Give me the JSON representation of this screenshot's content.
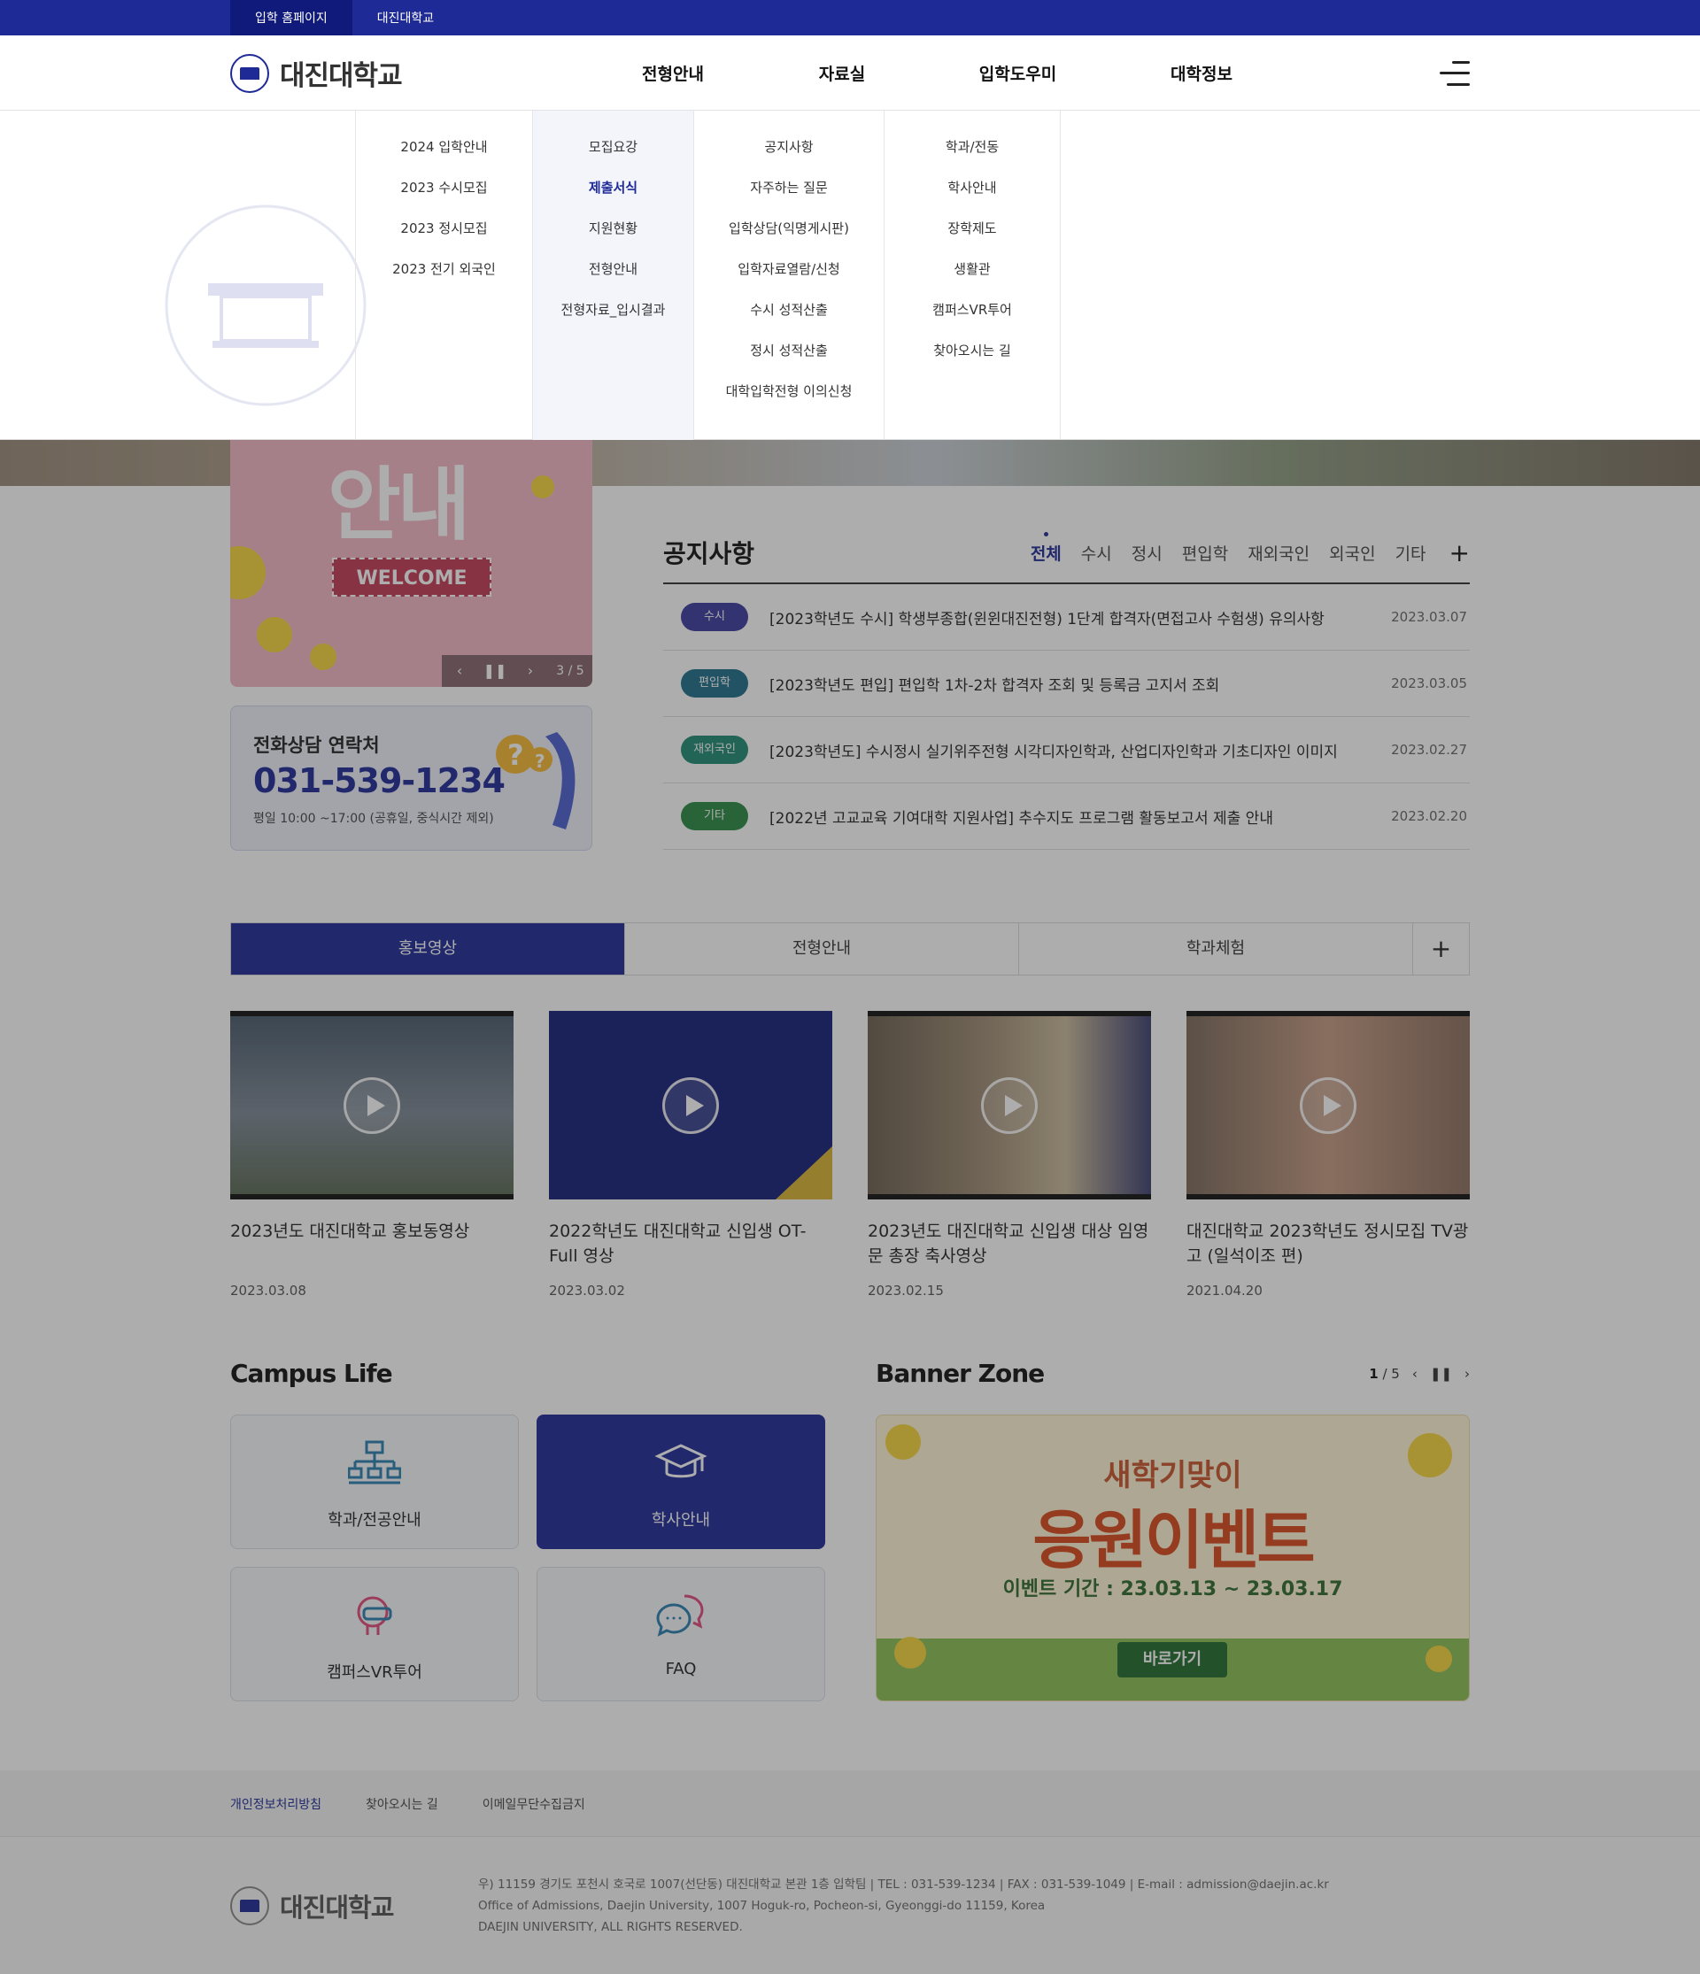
{
  "util_bar": {
    "links": [
      "입학 홈페이지",
      "대진대학교"
    ]
  },
  "header": {
    "logo_text": "대진대학교",
    "gnb": [
      "전형안내",
      "자료실",
      "입학도우미",
      "대학정보"
    ]
  },
  "mega_menu": {
    "col1": [
      "2024 입학안내",
      "2023 수시모집",
      "2023 정시모집",
      "2023 전기 외국인"
    ],
    "col2": [
      "모집요강",
      "제출서식",
      "지원현황",
      "전형안내",
      "전형자료_입시결과"
    ],
    "col3": [
      "공지사항",
      "자주하는 질문",
      "입학상담(익명게시판)",
      "입학자료열람/신청",
      "수시 성적산출",
      "정시 성적산출",
      "대학입학전형 이의신청"
    ],
    "col4": [
      "학과/전동",
      "학사안내",
      "장학제도",
      "생활관",
      "캠퍼스VR투어",
      "찾아오시는 길"
    ],
    "active_item": "제출서식"
  },
  "promo": {
    "title": "안내",
    "welcome": "WELCOME",
    "counter": "3 / 5"
  },
  "call": {
    "title": "전화상담 연락처",
    "number": "031-539-1234",
    "hours": "평일 10:00 ~17:00 (공휴일, 중식시간 제외)"
  },
  "notice": {
    "title": "공지사항",
    "tabs": [
      "전체",
      "수시",
      "정시",
      "편입학",
      "재외국인",
      "외국인",
      "기타"
    ],
    "rows": [
      {
        "badge": "수시",
        "badge_color": "#3b3a9e",
        "title": "[2023학년도 수시] 학생부종합(윈윈대진전형) 1단계 합격자(면접고사 수험생) 유의사항",
        "date": "2023.03.07"
      },
      {
        "badge": "편입학",
        "badge_color": "#1e6f8a",
        "title": "[2023학년도 편입] 편입학 1차-2차 합격자 조회 및 등록금 고지서 조회",
        "date": "2023.03.05"
      },
      {
        "badge": "재외국인",
        "badge_color": "#1f8a73",
        "title": "[2023학년도] 수시정시 실기위주전형 시각디자인학과, 산업디자인학과 기초디자인 이미지",
        "date": "2023.02.27"
      },
      {
        "badge": "기타",
        "badge_color": "#2b8a44",
        "title": "[2022년 고교교육 기여대학 지원사업] 추수지도 프로그램 활동보고서 제출 안내",
        "date": "2023.02.20"
      }
    ]
  },
  "video_tabs": [
    "홍보영상",
    "전형안내",
    "학과체험"
  ],
  "videos": [
    {
      "title": "2023년도 대진대학교 홍보동영상",
      "date": "2023.03.08"
    },
    {
      "title": "2022학년도 대진대학교 신입생 OT- Full 영상",
      "date": "2023.03.02"
    },
    {
      "title": "2023년도 대진대학교 신입생 대상 임영문 총장 축사영상",
      "date": "2023.02.15"
    },
    {
      "title": "대진대학교 2023학년도 정시모집 TV광고 (일석이조 편)",
      "date": "2021.04.20"
    }
  ],
  "campus": {
    "title": "Campus Life",
    "cards": [
      "학과/전공안내",
      "학사안내",
      "캠퍼스VR투어",
      "FAQ"
    ]
  },
  "banner_zone": {
    "title": "Banner Zone",
    "counter_current": "1",
    "counter_total": "/ 5",
    "line1": "새학기맞이",
    "line2": "응원이벤트",
    "line3": "이벤트 기간 : 23.03.13 ~ 23.03.17",
    "button": "바로가기"
  },
  "footer": {
    "links": [
      "개인정보처리방침",
      "찾아오시는 길",
      "이메일무단수집금지"
    ],
    "logo_text": "대진대학교",
    "addr1": "우) 11159 경기도 포천시 호국로 1007(선단동) 대진대학교 본관 1층 입학팀  |  TEL : 031-539-1234  |  FAX : 031-539-1049  |  E-mail : admission@daejin.ac.kr",
    "addr2": "Office of Admissions, Daejin University, 1007 Hoguk-ro, Pocheon-si, Gyeonggi-do 11159, Korea",
    "addr3": "DAEJIN UNIVERSITY, ALL RIGHTS RESERVED."
  }
}
